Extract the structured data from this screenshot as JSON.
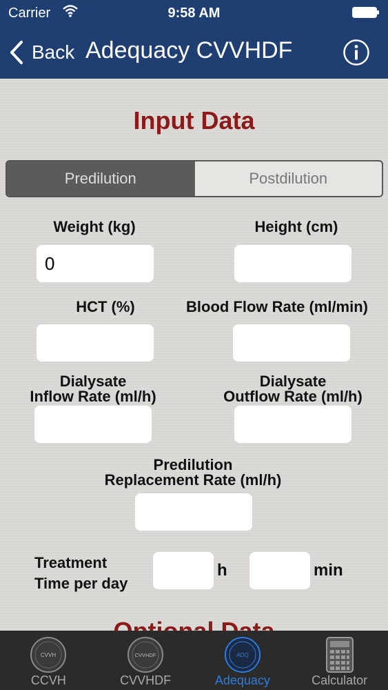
{
  "status": {
    "carrier": "Carrier",
    "time": "9:58 AM"
  },
  "nav": {
    "back_label": "Back",
    "title": "Adequacy CVVHDF"
  },
  "content": {
    "input_title": "Input Data",
    "optional_title": "Optional Data",
    "segments": [
      "Predilution",
      "Postdilution"
    ],
    "selected_segment": "Predilution",
    "fields": {
      "weight_label": "Weight (kg)",
      "weight_value": "0",
      "height_label": "Height (cm)",
      "height_value": "",
      "hct_label": "HCT (%)",
      "hct_value": "",
      "bfr_label": "Blood Flow Rate (ml/min)",
      "bfr_value": "",
      "dial_in_label_1": "Dialysate",
      "dial_in_label_2": "Inflow Rate (ml/h)",
      "dial_in_value": "",
      "dial_out_label_1": "Dialysate",
      "dial_out_label_2": "Outflow Rate (ml/h)",
      "dial_out_value": "",
      "replacement_label_1": "Predilution",
      "replacement_label_2": "Replacement Rate (ml/h)",
      "replacement_value": "",
      "treatment_label_1": "Treatment",
      "treatment_label_2": "Time per day",
      "hours_value": "",
      "hours_unit": "h",
      "minutes_value": "",
      "minutes_unit": "min"
    }
  },
  "tabs": [
    {
      "label": "CCVH",
      "icon_text": "CVVH",
      "icon": "cvvh-icon"
    },
    {
      "label": "CVVHDF",
      "icon_text": "CVVHDF",
      "icon": "cvvhdf-icon"
    },
    {
      "label": "Adequacy",
      "icon_text": "ADQ",
      "icon": "adequacy-icon"
    },
    {
      "label": "Calculator",
      "icon": "calculator-icon"
    }
  ],
  "active_tab": "Adequacy",
  "colors": {
    "nav": "#1f3f73",
    "title_red": "#8b1a1a",
    "active_tab": "#2d7be0",
    "tab_bar": "#2b2b2b"
  }
}
